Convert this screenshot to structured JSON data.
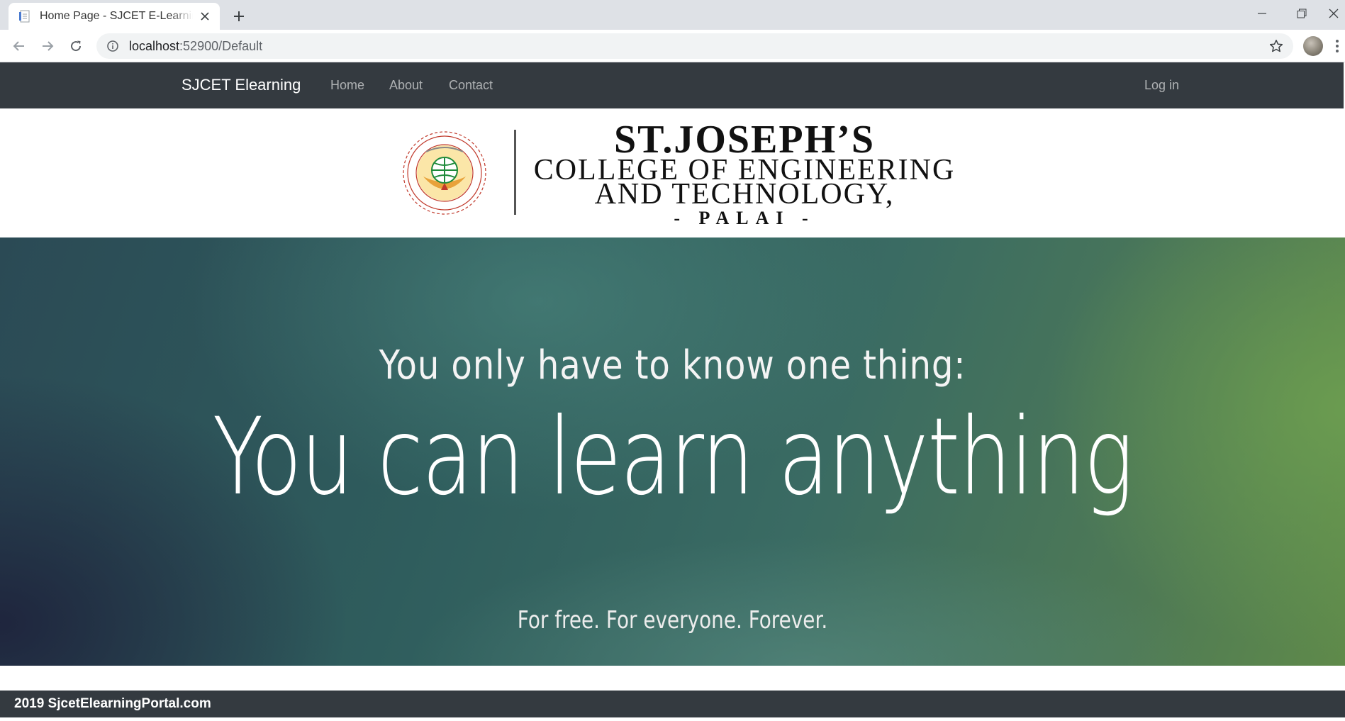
{
  "browser": {
    "tab_title": "Home Page - SJCET E-Learning Portal",
    "url_host": "localhost",
    "url_rest": ":52900/Default"
  },
  "navbar": {
    "brand": "SJCET Elearning",
    "links": [
      "Home",
      "About",
      "Contact"
    ],
    "login": "Log in"
  },
  "logo": {
    "line1": "ST.JOSEPH’S",
    "line2": "COLLEGE OF ENGINEERING",
    "line3": "AND TECHNOLOGY,",
    "line4": "- PALAI -"
  },
  "hero": {
    "line1": "You only have to know one thing:",
    "line2": "You can learn anything",
    "line3": "For free. For everyone. Forever."
  },
  "footer": {
    "text": "2019 SjcetElearningPortal.com"
  },
  "colors": {
    "navbar_bg": "#343a40",
    "tabstrip_bg": "#dee1e6"
  }
}
